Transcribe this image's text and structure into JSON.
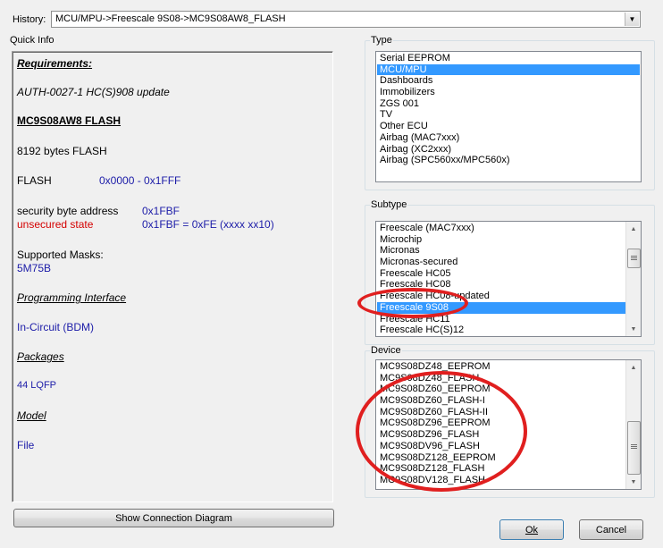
{
  "history": {
    "label": "History:",
    "value": "MCU/MPU->Freescale 9S08->MC9S08AW8_FLASH"
  },
  "quick_info": {
    "label": "Quick Info",
    "requirements": "Requirements:",
    "auth": "AUTH-0027-1  HC(S)908 update",
    "device": "MC9S08AW8 FLASH",
    "flash_size": "8192 bytes FLASH",
    "flash_label": "FLASH",
    "flash_range": "0x0000 - 0x1FFF",
    "sec_label": "security byte address",
    "sec_value": "0x1FBF",
    "unsecured_label": "unsecured state",
    "unsecured_value": "0x1FBF = 0xFE (xxxx xx10)",
    "masks_label": "Supported Masks:",
    "masks_value": "5M75B",
    "prog_label": "Programming Interface",
    "prog_value": "In-Circuit (BDM)",
    "pkg_label": "Packages",
    "pkg_value": "44 LQFP",
    "model_label": "Model",
    "model_value": "File"
  },
  "show_connection_label": "Show Connection Diagram",
  "type": {
    "label": "Type",
    "items": [
      "Serial EEPROM",
      "MCU/MPU",
      "Dashboards",
      "Immobilizers",
      "ZGS 001",
      "TV",
      "Other ECU",
      "Airbag (MAC7xxx)",
      "Airbag (XC2xxx)",
      "Airbag (SPC560xx/MPC560x)"
    ],
    "selected": "MCU/MPU"
  },
  "subtype": {
    "label": "Subtype",
    "items": [
      "Freescale (MAC7xxx)",
      "Microchip",
      "Micronas",
      "Micronas-secured",
      "Freescale HC05",
      "Freescale HC08",
      "Freescale HC08-updated",
      "Freescale 9S08",
      "Freescale HC11",
      "Freescale HC(S)12"
    ],
    "selected": "Freescale 9S08"
  },
  "device": {
    "label": "Device",
    "items": [
      "MC9S08DZ48_EEPROM",
      "MC9S08DZ48_FLASH",
      "MC9S08DZ60_EEPROM",
      "MC9S08DZ60_FLASH-I",
      "MC9S08DZ60_FLASH-II",
      "MC9S08DZ96_EEPROM",
      "MC9S08DZ96_FLASH",
      "MC9S08DV96_FLASH",
      "MC9S08DZ128_EEPROM",
      "MC9S08DZ128_FLASH",
      "MC9S08DV128_FLASH"
    ]
  },
  "ok_label": "Ok",
  "cancel_label": "Cancel",
  "colors": {
    "selection": "#3399ff",
    "annotation": "#e01f1f",
    "info_blue": "#1c1ca8",
    "info_red": "#d40000"
  }
}
